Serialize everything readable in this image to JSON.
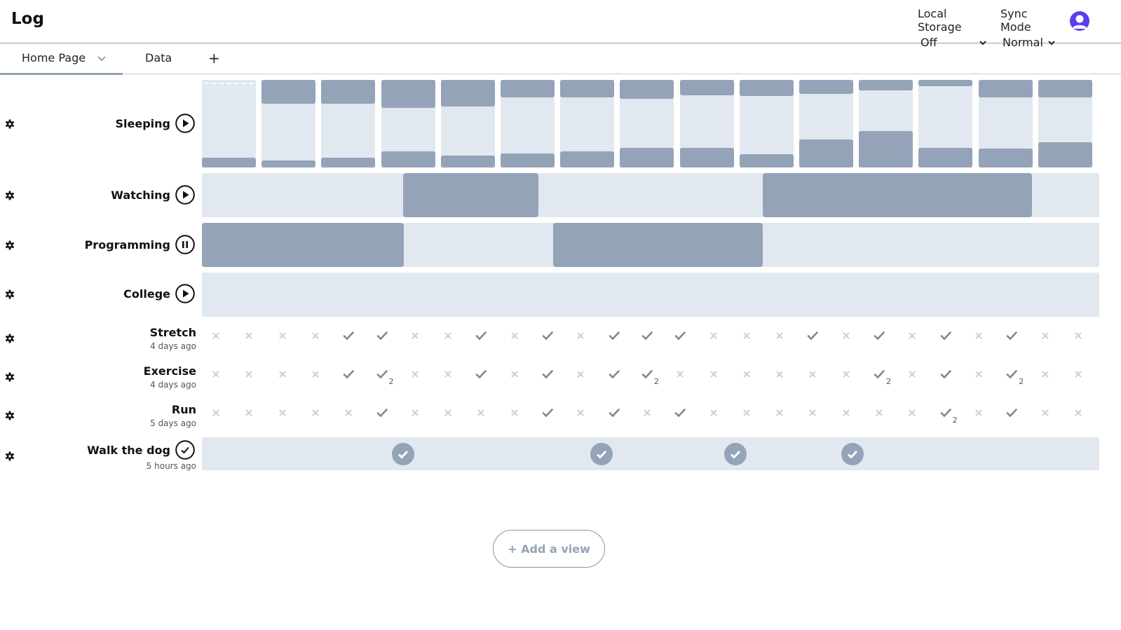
{
  "app": {
    "title": "Log"
  },
  "header": {
    "local_storage": {
      "label": "Local Storage",
      "value": "Off"
    },
    "sync_mode": {
      "label": "Sync Mode",
      "value": "Normal"
    }
  },
  "tabs": [
    {
      "label": "Home Page",
      "active": true
    },
    {
      "label": "Data",
      "active": false
    }
  ],
  "add_tab_label": "+",
  "rows": [
    {
      "name": "Sleeping",
      "control": "play-icon"
    },
    {
      "name": "Watching",
      "control": "play-icon"
    },
    {
      "name": "Programming",
      "control": "pause-icon"
    },
    {
      "name": "College",
      "control": "play-icon"
    },
    {
      "name": "Stretch",
      "subtitle": "4 days ago"
    },
    {
      "name": "Exercise",
      "subtitle": "4 days ago"
    },
    {
      "name": "Run",
      "subtitle": "5 days ago"
    },
    {
      "name": "Walk the dog",
      "subtitle": "5 hours ago",
      "control": "check-icon"
    }
  ],
  "habits": {
    "stretch": [
      "x",
      "x",
      "x",
      "x",
      "v",
      "v",
      "x",
      "x",
      "v",
      "x",
      "v",
      "x",
      "v",
      "v",
      "v",
      "x",
      "x",
      "x",
      "v",
      "x",
      "v",
      "x",
      "v",
      "x",
      "v",
      "x",
      "x"
    ],
    "exercise": [
      "x",
      "x",
      "x",
      "x",
      "v",
      "v2",
      "x",
      "x",
      "v",
      "x",
      "v",
      "x",
      "v",
      "v2",
      "x",
      "x",
      "x",
      "x",
      "x",
      "x",
      "v2",
      "x",
      "v",
      "x",
      "v2",
      "x",
      "x"
    ],
    "run": [
      "x",
      "x",
      "x",
      "x",
      "x",
      "v",
      "x",
      "x",
      "x",
      "x",
      "v",
      "x",
      "v",
      "x",
      "v",
      "x",
      "x",
      "x",
      "x",
      "x",
      "x",
      "x",
      "v2",
      "x",
      "v",
      "x",
      "x"
    ]
  },
  "add_view_label": "+ Add a view"
}
